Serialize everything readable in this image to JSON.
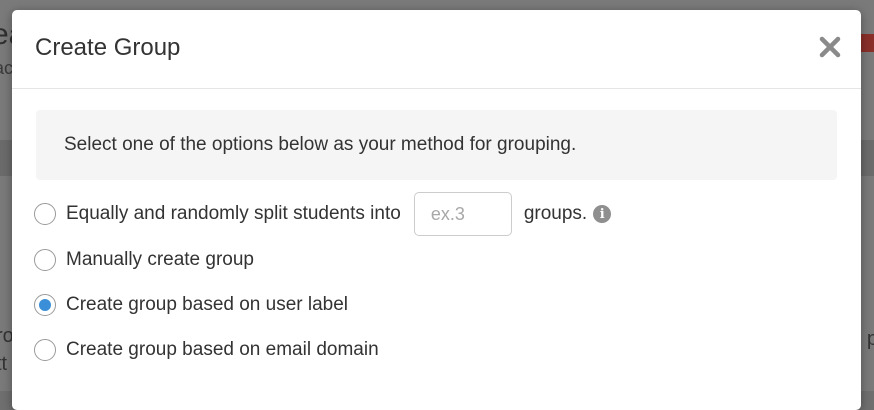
{
  "background": {
    "title_fragment": "ea",
    "subtitle_fragment": "ac",
    "left_fragment_1": "ro",
    "left_fragment_2": "tt",
    "right_fragment": "p"
  },
  "modal": {
    "title": "Create Group",
    "close_icon": "close-icon",
    "instructions": "Select one of the options below as your method for grouping.",
    "options": [
      {
        "label_before": "Equally and randomly split students into",
        "input_placeholder": "ex.3",
        "input_value": "",
        "label_after": "groups.",
        "info_icon": "info-icon",
        "selected": false
      },
      {
        "label": "Manually create group",
        "selected": false
      },
      {
        "label": "Create group based on user label",
        "selected": true
      },
      {
        "label": "Create group based on email domain",
        "selected": false
      }
    ]
  },
  "colors": {
    "accent": "#3b8fd8",
    "overlay": "#7a7a7a"
  }
}
